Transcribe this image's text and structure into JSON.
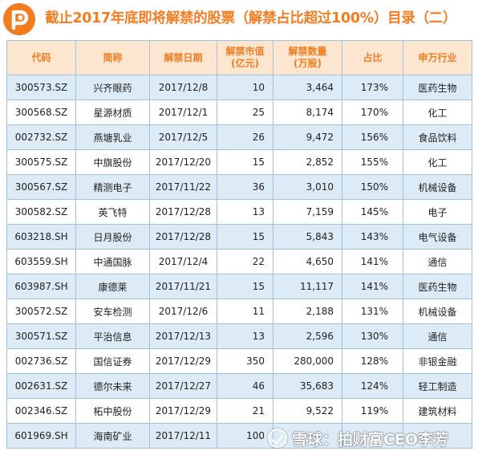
{
  "title": "截止2017年底即将解禁的股票（解禁占比超过100%）目录（二）",
  "logo_icon": "p-logo-icon",
  "accent_color": "#f47c20",
  "headers": {
    "code": "代码",
    "name": "简称",
    "date": "解禁日期",
    "value": "解禁市值\n(亿元)",
    "shares": "解禁数量\n(万股)",
    "ratio": "占比",
    "industry": "申万行业"
  },
  "rows": [
    {
      "code": "300573.SZ",
      "name": "兴齐眼药",
      "date": "2017/12/8",
      "value": "10",
      "shares": "3,464",
      "ratio": "173%",
      "industry": "医药生物"
    },
    {
      "code": "300568.SZ",
      "name": "星源材质",
      "date": "2017/12/1",
      "value": "25",
      "shares": "8,174",
      "ratio": "170%",
      "industry": "化工"
    },
    {
      "code": "002732.SZ",
      "name": "燕塘乳业",
      "date": "2017/12/5",
      "value": "26",
      "shares": "9,472",
      "ratio": "156%",
      "industry": "食品饮料"
    },
    {
      "code": "300575.SZ",
      "name": "中旗股份",
      "date": "2017/12/20",
      "value": "15",
      "shares": "2,852",
      "ratio": "155%",
      "industry": "化工"
    },
    {
      "code": "300567.SZ",
      "name": "精测电子",
      "date": "2017/11/22",
      "value": "36",
      "shares": "3,010",
      "ratio": "150%",
      "industry": "机械设备"
    },
    {
      "code": "300582.SZ",
      "name": "英飞特",
      "date": "2017/12/28",
      "value": "13",
      "shares": "7,159",
      "ratio": "145%",
      "industry": "电子"
    },
    {
      "code": "603218.SH",
      "name": "日月股份",
      "date": "2017/12/28",
      "value": "15",
      "shares": "5,843",
      "ratio": "143%",
      "industry": "电气设备"
    },
    {
      "code": "603559.SH",
      "name": "中通国脉",
      "date": "2017/12/4",
      "value": "22",
      "shares": "4,650",
      "ratio": "141%",
      "industry": "通信"
    },
    {
      "code": "603987.SH",
      "name": "康德莱",
      "date": "2017/11/21",
      "value": "15",
      "shares": "11,117",
      "ratio": "141%",
      "industry": "医药生物"
    },
    {
      "code": "300572.SZ",
      "name": "安车检测",
      "date": "2017/12/6",
      "value": "11",
      "shares": "2,188",
      "ratio": "131%",
      "industry": "机械设备"
    },
    {
      "code": "300571.SZ",
      "name": "平治信息",
      "date": "2017/12/13",
      "value": "13",
      "shares": "2,596",
      "ratio": "130%",
      "industry": "通信"
    },
    {
      "code": "002736.SZ",
      "name": "国信证券",
      "date": "2017/12/29",
      "value": "350",
      "shares": "280,000",
      "ratio": "128%",
      "industry": "非银金融"
    },
    {
      "code": "002631.SZ",
      "name": "德尔未来",
      "date": "2017/12/27",
      "value": "46",
      "shares": "35,683",
      "ratio": "124%",
      "industry": "轻工制造"
    },
    {
      "code": "002346.SZ",
      "name": "柘中股份",
      "date": "2017/12/29",
      "value": "21",
      "shares": "9,522",
      "ratio": "119%",
      "industry": "建筑材料"
    },
    {
      "code": "601969.SH",
      "name": "海南矿业",
      "date": "2017/12/11",
      "value": "100",
      "shares": "",
      "ratio": "",
      "industry": ""
    }
  ],
  "watermark": "雪球：拍财富CEO李芳"
}
